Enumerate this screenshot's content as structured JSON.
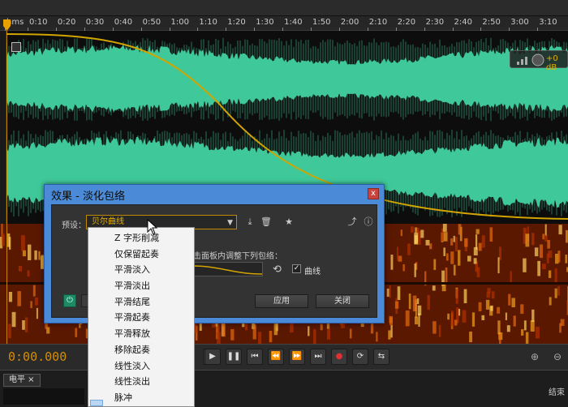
{
  "ruler": {
    "unit": "hms",
    "ticks": [
      "0:10",
      "0:20",
      "0:30",
      "0:40",
      "0:50",
      "1:00",
      "1:10",
      "1:20",
      "1:30",
      "1:40",
      "1:50",
      "2:00",
      "2:10",
      "2:20",
      "2:30",
      "2:40",
      "2:50",
      "3:00",
      "3:10"
    ]
  },
  "hud": {
    "label": "+0 dB"
  },
  "dialog": {
    "title": "效果 - 淡化包络",
    "close": "x",
    "preset_label": "预设：",
    "preset_value": "贝尔曲线",
    "hint": "击面板内调整下列包络：",
    "curve_label": "曲线",
    "curve_checked": "✓",
    "apply": "应用",
    "close_button": "关闭"
  },
  "menu": {
    "items": [
      "Z 字形削减",
      "仅保留起奏",
      "平滑淡入",
      "平滑淡出",
      "平滑结尾",
      "平滑起奏",
      "平滑释放",
      "移除起奏",
      "线性淡入",
      "线性淡出",
      "脉冲"
    ]
  },
  "transport": {
    "time": "0:00.000"
  },
  "bottom": {
    "level_tab": "电平 ×",
    "end_label": "结束"
  },
  "colors": {
    "waveform": "#3fc99b",
    "envelope": "#d2a400",
    "accent": "#e6b100",
    "dialog_title": "#4b8ad6"
  }
}
